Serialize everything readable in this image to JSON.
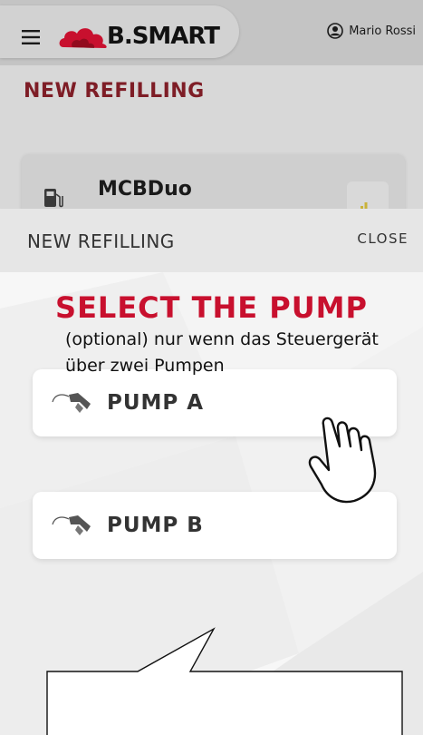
{
  "header": {
    "brand": "B.SMART",
    "user_name": "Mario Rossi"
  },
  "background_page": {
    "title": "NEW REFILLING",
    "card_title": "MCBDuo"
  },
  "modal": {
    "title": "NEW REFILLING",
    "close_label": "CLOSE",
    "heading": "SELECT THE PUMP",
    "pumps": [
      {
        "label": "PUMP A"
      },
      {
        "label": "PUMP B"
      }
    ]
  },
  "callout": {
    "text": "(optional) nur wenn das Steuergerät über zwei Pumpen"
  },
  "colors": {
    "accent": "#c8102e",
    "brand_red": "#c8102e",
    "dim_title": "#7e1d26"
  },
  "icons": {
    "menu": "hamburger-icon",
    "user": "user-circle-icon",
    "station": "fuel-station-icon",
    "signal": "signal-bars-icon",
    "nozzle": "fuel-nozzle-icon",
    "pointer": "pointing-hand-icon"
  }
}
